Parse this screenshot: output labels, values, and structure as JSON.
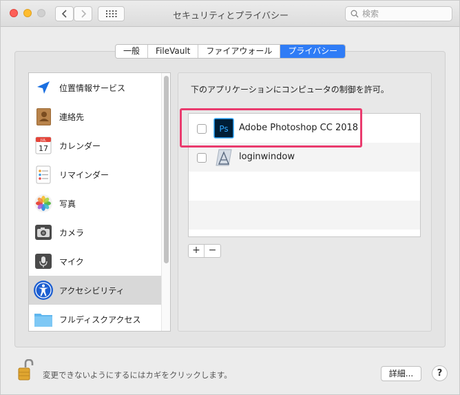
{
  "window": {
    "title": "セキュリティとプライバシー",
    "search_placeholder": "検索"
  },
  "tabs": [
    {
      "label": "一般",
      "active": false
    },
    {
      "label": "FileVault",
      "active": false
    },
    {
      "label": "ファイアウォール",
      "active": false
    },
    {
      "label": "プライバシー",
      "active": true
    }
  ],
  "sidebar": {
    "items": [
      {
        "label": "位置情報サービス",
        "icon": "location-arrow-icon"
      },
      {
        "label": "連絡先",
        "icon": "contacts-book-icon"
      },
      {
        "label": "カレンダー",
        "icon": "calendar-icon"
      },
      {
        "label": "リマインダー",
        "icon": "reminders-icon"
      },
      {
        "label": "写真",
        "icon": "photos-icon"
      },
      {
        "label": "カメラ",
        "icon": "camera-icon"
      },
      {
        "label": "マイク",
        "icon": "microphone-icon"
      },
      {
        "label": "アクセシビリティ",
        "icon": "accessibility-icon",
        "selected": true
      },
      {
        "label": "フルディスクアクセス",
        "icon": "folder-icon"
      }
    ],
    "calendar_month": "JUL",
    "calendar_day": "17"
  },
  "main": {
    "caption": "下のアプリケーションにコンピュータの制御を許可。",
    "apps": [
      {
        "label": "Adobe Photoshop CC 2018",
        "icon": "photoshop-icon",
        "checked": false,
        "icon_text": "Ps"
      },
      {
        "label": "loginwindow",
        "icon": "loginwindow-icon",
        "checked": false
      }
    ],
    "add_label": "+",
    "remove_label": "−"
  },
  "footer": {
    "lock_text": "変更できないようにするにはカギをクリックします。",
    "details_label": "詳細...",
    "help_label": "?"
  },
  "colors": {
    "accent": "#2f7cf6",
    "highlight": "#ea3b6e",
    "photoshop_bg": "#001e36",
    "photoshop_fg": "#31a8ff"
  }
}
